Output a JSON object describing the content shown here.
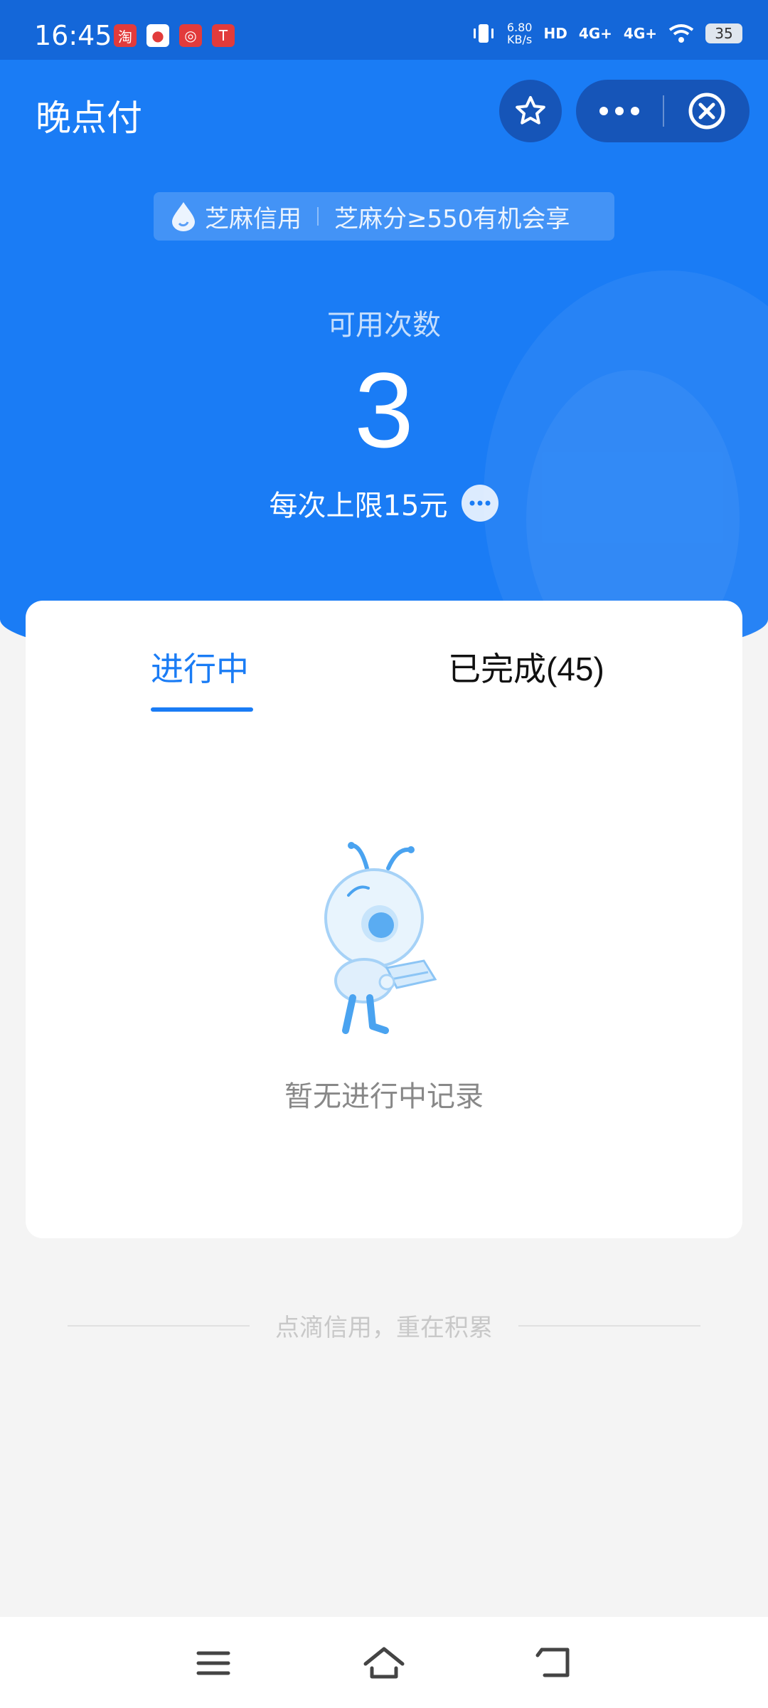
{
  "status_bar": {
    "time": "16:45",
    "net_speed_value": "6.80",
    "net_speed_unit": "KB/s",
    "hd_label": "HD",
    "signal1": "4G+",
    "signal2": "4G+",
    "battery": "35",
    "notification_icons": [
      "taobao-icon",
      "notification-icon",
      "app-icon",
      "tesla-icon"
    ]
  },
  "header": {
    "title": "晚点付",
    "favorite_icon": "star-icon",
    "more_icon": "more-dots-icon",
    "close_icon": "close-circle-icon"
  },
  "credit_banner": {
    "brand": "芝麻信用",
    "text": "芝麻分≥550有机会享"
  },
  "summary": {
    "count_label": "可用次数",
    "count_value": "3",
    "limit_text": "每次上限15元"
  },
  "tabs": [
    {
      "label": "进行中",
      "active": true
    },
    {
      "label": "已完成(45)",
      "active": false
    }
  ],
  "empty_state": {
    "text": "暂无进行中记录"
  },
  "footer": {
    "slogan": "点滴信用，重在积累"
  },
  "colors": {
    "primary": "#1a7cf5",
    "background": "#f4f4f4"
  },
  "nav": [
    "menu-icon",
    "home-icon",
    "back-icon"
  ]
}
